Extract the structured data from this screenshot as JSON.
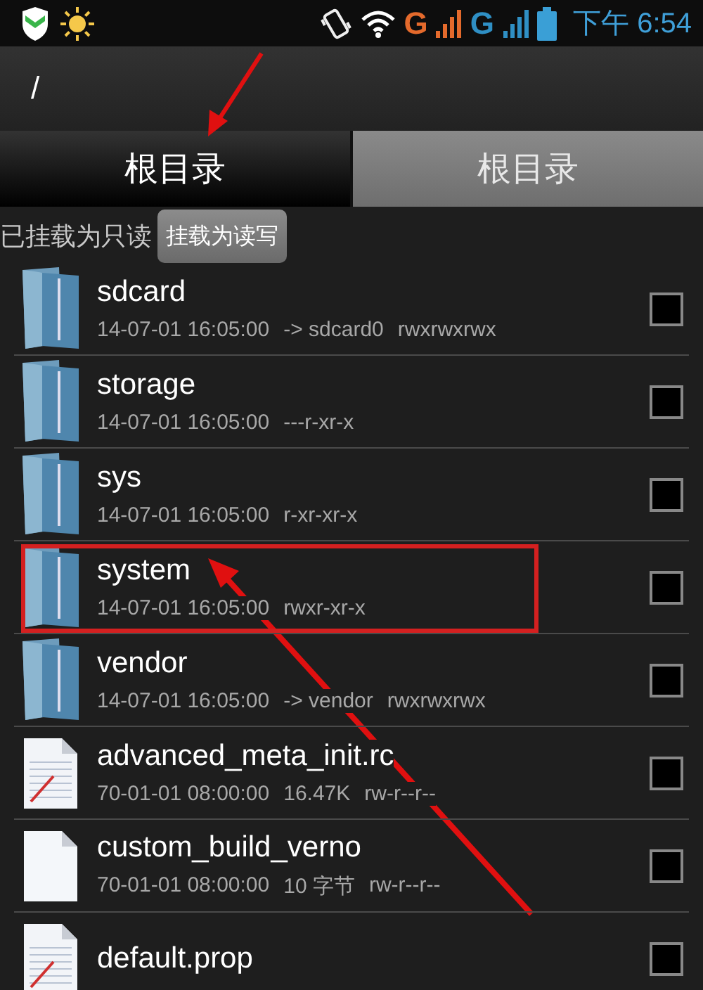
{
  "status_bar": {
    "network_1": "G",
    "network_2": "G",
    "time": "下午 6:54"
  },
  "path": "/",
  "tabs": [
    {
      "label": "根目录",
      "selected": true
    },
    {
      "label": "根目录",
      "selected": false
    }
  ],
  "mount": {
    "status": "已挂载为只读",
    "button": "挂载为读写"
  },
  "files": [
    {
      "kind": "folder",
      "name": "sdcard",
      "date": "14-07-01 16:05:00",
      "info": "-> sdcard0",
      "permissions": "rwxrwxrwx",
      "checked": false,
      "highlighted": false
    },
    {
      "kind": "folder",
      "name": "storage",
      "date": "14-07-01 16:05:00",
      "permissions": "---r-xr-x",
      "checked": false,
      "highlighted": false
    },
    {
      "kind": "folder",
      "name": "sys",
      "date": "14-07-01 16:05:00",
      "permissions": "r-xr-xr-x",
      "checked": false,
      "highlighted": false
    },
    {
      "kind": "folder",
      "name": "system",
      "date": "14-07-01 16:05:00",
      "permissions": "rwxr-xr-x",
      "checked": false,
      "highlighted": true
    },
    {
      "kind": "folder",
      "name": "vendor",
      "date": "14-07-01 16:05:00",
      "info": "-> vendor",
      "permissions": "rwxrwxrwx",
      "checked": false,
      "highlighted": false
    },
    {
      "kind": "text",
      "name": "advanced_meta_init.rc",
      "date": "70-01-01 08:00:00",
      "info": "16.47K",
      "permissions": "rw-r--r--",
      "checked": false,
      "highlighted": false
    },
    {
      "kind": "blank",
      "name": "custom_build_verno",
      "date": "70-01-01 08:00:00",
      "info": "10 字节",
      "permissions": "rw-r--r--",
      "checked": false,
      "highlighted": false
    },
    {
      "kind": "text",
      "name": "default.prop",
      "checked": false,
      "highlighted": false
    }
  ]
}
